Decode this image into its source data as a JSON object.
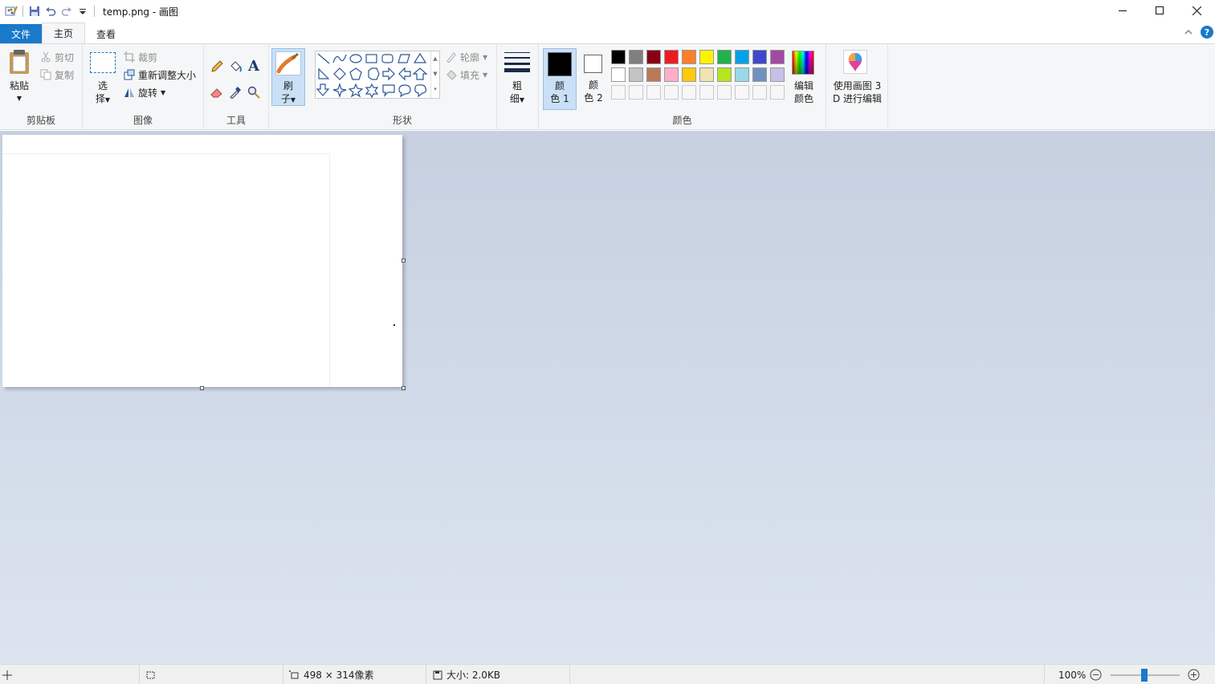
{
  "titlebar": {
    "title": "temp.png - 画图",
    "app_icon": "paint-app-icon",
    "quick_access": [
      "save-icon",
      "undo-icon",
      "redo-icon",
      "customize-dropdown-icon"
    ]
  },
  "tabs": {
    "file": "文件",
    "home": "主页",
    "view": "查看"
  },
  "clipboard": {
    "paste": "粘贴",
    "cut": "剪切",
    "copy": "复制",
    "group": "剪贴板"
  },
  "image": {
    "select_top": "选",
    "select_bottom": "择",
    "crop": "裁剪",
    "resize": "重新调整大小",
    "rotate": "旋转",
    "group": "图像"
  },
  "tools": {
    "group": "工具",
    "text_glyph": "A"
  },
  "brushes": {
    "top": "刷",
    "bottom": "子"
  },
  "shapes": {
    "outline": "轮廓",
    "fill": "填充",
    "group": "形状"
  },
  "size": {
    "top": "粗",
    "bottom": "细"
  },
  "colors": {
    "color1_top": "颜",
    "color1_bottom": "色 1",
    "color2_top": "颜",
    "color2_bottom": "色 2",
    "edit_top": "编辑",
    "edit_bottom": "颜色",
    "group": "颜色",
    "color1_value": "#000000",
    "color2_value": "#ffffff",
    "palette_row1": [
      "#000000",
      "#7f7f7f",
      "#880015",
      "#ed1c24",
      "#ff7f27",
      "#fff200",
      "#22b14c",
      "#00a2e8",
      "#3f48cc",
      "#a349a4"
    ],
    "palette_row2": [
      "#ffffff",
      "#c3c3c3",
      "#b97a57",
      "#ffaec9",
      "#ffc90e",
      "#efe4b0",
      "#b5e61d",
      "#99d9ea",
      "#7092be",
      "#c8bfe7"
    ]
  },
  "paint3d": {
    "line1": "使用画图 3",
    "line2": "D 进行编辑"
  },
  "status": {
    "dimensions": "498 × 314像素",
    "file_size": "大小: 2.0KB",
    "zoom": "100%"
  },
  "accent": "#1979ca"
}
